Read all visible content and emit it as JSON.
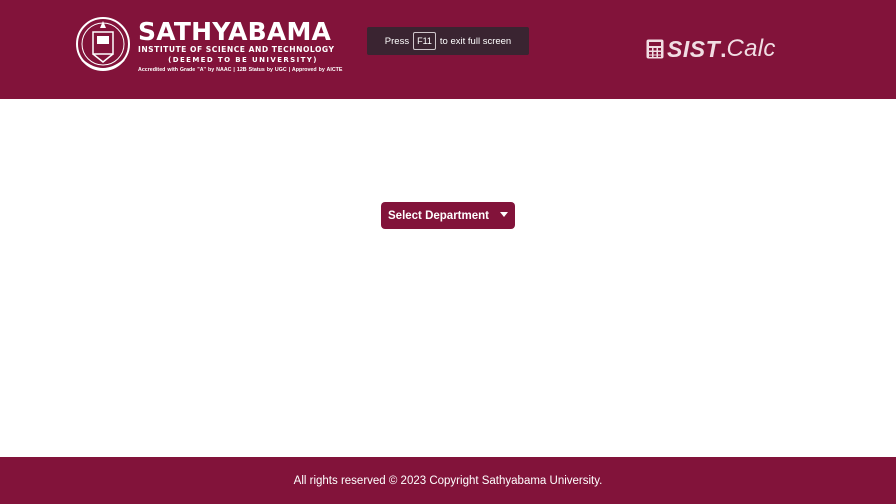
{
  "header": {
    "logo": {
      "name": "SATHYABAMA",
      "subtitle": "INSTITUTE OF SCIENCE AND TECHNOLOGY",
      "deemed": "(DEEMED TO BE UNIVERSITY)",
      "accreditation": "Accredited with Grade \"A\" by NAAC  |  12B Status by UGC  |  Approved by AICTE",
      "emblem_icon": "university-emblem-icon"
    },
    "fullscreen_notice": {
      "prefix": "Press",
      "key": "F11",
      "suffix": "to exit full screen"
    },
    "brand": {
      "icon": "calculator-icon",
      "sist": "SIST",
      "dot": ".",
      "calc": "Calc"
    }
  },
  "main": {
    "department_dropdown": {
      "label": "Select Department",
      "icon": "caret-down-icon"
    }
  },
  "footer": {
    "text": "All rights reserved © 2023 Copyright Sathyabama University."
  },
  "colors": {
    "primary": "#82133a",
    "notice_bg": "#3a2431",
    "brand_text": "#f1dde3",
    "background": "#ffffff"
  }
}
